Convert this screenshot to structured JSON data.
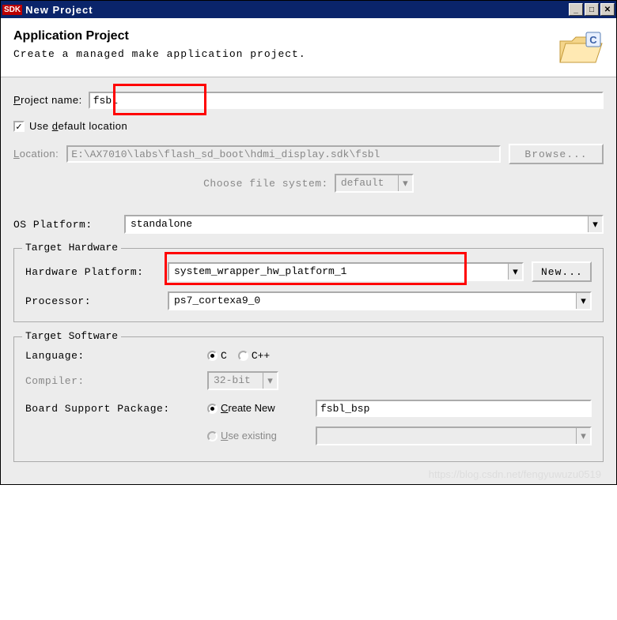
{
  "titlebar": {
    "icon_text": "SDK",
    "title": "New Project"
  },
  "header": {
    "title": "Application Project",
    "description": "Create a managed make application project."
  },
  "project": {
    "name_label_pre": "P",
    "name_label_post": "roject name:",
    "name_value": "fsbl",
    "use_default_label_pre": "Use ",
    "use_default_underline": "d",
    "use_default_post": "efault location",
    "use_default_checked": "✓",
    "location_label_pre": "L",
    "location_label_post": "ocation:",
    "location_value": "E:\\AX7010\\labs\\flash_sd_boot\\hdmi_display.sdk\\fsbl",
    "browse_label": "Browse...",
    "choose_fs_label": "Choose file system:",
    "choose_fs_value": "default"
  },
  "os_platform": {
    "label": "OS Platform:",
    "value": "standalone"
  },
  "target_hardware": {
    "legend": "Target Hardware",
    "hw_platform_label": "Hardware Platform:",
    "hw_platform_value": "system_wrapper_hw_platform_1",
    "new_button": "New...",
    "processor_label": "Processor:",
    "processor_value": "ps7_cortexa9_0"
  },
  "target_software": {
    "legend": "Target Software",
    "language_label": "Language:",
    "lang_c": "C",
    "lang_cpp": "C++",
    "compiler_label": "Compiler:",
    "compiler_value": "32-bit",
    "bsp_label": "Board Support Package:",
    "bsp_create_pre": "C",
    "bsp_create_post": "reate New",
    "bsp_name": "fsbl_bsp",
    "bsp_use_pre": "U",
    "bsp_use_post": "se existing"
  },
  "watermark": "https://blog.csdn.net/fengyuwuzu0519"
}
